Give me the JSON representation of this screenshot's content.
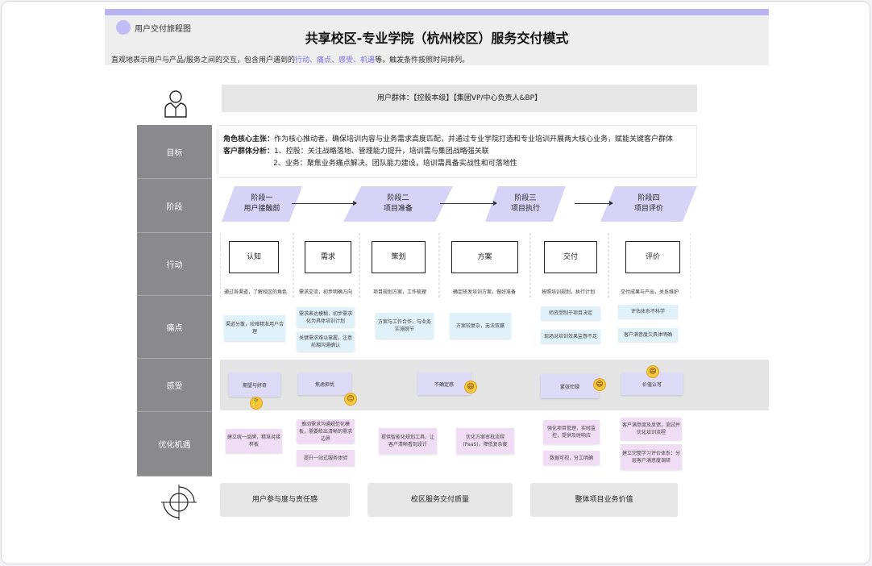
{
  "header": {
    "logo_label": "用户交付旅程图",
    "title": "共享校区-专业学院（杭州校区）服务交付模式",
    "subtitle_pre": "直观地表示用户与产品/服务之间的交互，包含用户遇到的",
    "subtitle_hl": "行动、痛点、感受、机遇",
    "subtitle_post": "等，触发条件按照时间排列。"
  },
  "user_group": "用户群体：【控股本级】【集团VP/中心负责人&BP】",
  "lanes": [
    "目标",
    "阶段",
    "行动",
    "痛点",
    "感受",
    "优化机遇"
  ],
  "goal": {
    "line1_label": "角色核心主张：",
    "line1_text": "作为核心推动者，确保培训内容与业务需求高度匹配，并通过专业学院打造和专业培训开展两大核心业务，赋能关键客户群体",
    "line2_label": "客户群体分析：",
    "line2_text": "1、控股：关注战略落地、管理能力提升，培训需与集团战略强关联",
    "line3_text": "2、业务：聚焦业务痛点解决、团队能力建设，培训需具备实战性和可落地性"
  },
  "stages": [
    {
      "l1": "阶段一",
      "l2": "用户接触前"
    },
    {
      "l1": "阶段二",
      "l2": "项目准备"
    },
    {
      "l1": "阶段三",
      "l2": "项目执行"
    },
    {
      "l1": "阶段四",
      "l2": "项目评价"
    }
  ],
  "actions": [
    {
      "label": "认知",
      "desc": "通过各渠道，了解校区的角色"
    },
    {
      "label": "需求",
      "desc": "需求交流，初步明确方向"
    },
    {
      "label": "策划",
      "desc": "项目规划方案，工作梳理"
    },
    {
      "label": "方案",
      "desc": "确定研发培训方案，做好准备"
    },
    {
      "label": "交付",
      "desc": "按照培训规划，执行计划"
    },
    {
      "label": "评价",
      "desc": "交付成果与产出，关系维护"
    }
  ],
  "pains": [
    "渠道分散，较难精准用户合理",
    "需求表达模糊，初步需求化为具体培训计划",
    "关键需求难以掌握，注意前期沟通确认",
    "方案与工作合作，与业务实施脱节",
    "方案较复杂，无法双赢",
    "师资受制于项目决定",
    "现场对培训效果监督不足",
    "评估体系不科学",
    "客户满意度欠具体明确"
  ],
  "feelings": [
    "期望与好奇",
    "焦虑担忧",
    "不确定感",
    "紧张忙碌",
    "价值认可"
  ],
  "emojis": [
    "🤔",
    "😊",
    "😄",
    "😄",
    "😄"
  ],
  "opportunities": [
    "建立统一品牌，精准对接样板",
    "推动需求沟通规范化模板，需要给出清晰的需求边界",
    "提升一站式服务体验",
    "提供智能化规划工具，让客户清晰看到设计",
    "优化方案审批流程(PaaS)，降低复杂度",
    "强化项目管理，实时监控，提供及时响应",
    "数据可视，分工明确",
    "客户满意度及反馈，测试并优化培训流程",
    "建立完整学习评价体系：分层客户满意度调研"
  ],
  "values": [
    "用户参与度与责任感",
    "校区服务交付质量",
    "整体项目业务价值"
  ]
}
